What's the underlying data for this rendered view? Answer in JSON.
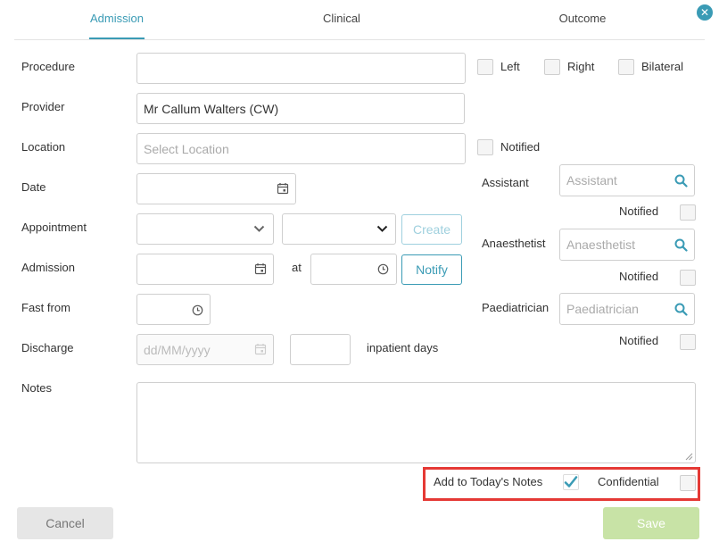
{
  "tabs": [
    {
      "label": "Admission",
      "active": true
    },
    {
      "label": "Clinical",
      "active": false
    },
    {
      "label": "Outcome",
      "active": false
    }
  ],
  "close": {
    "icon": "close-icon"
  },
  "form": {
    "procedure": {
      "label": "Procedure",
      "value": ""
    },
    "side_options": [
      {
        "label": "Left",
        "checked": false
      },
      {
        "label": "Right",
        "checked": false
      },
      {
        "label": "Bilateral",
        "checked": false
      }
    ],
    "provider": {
      "label": "Provider",
      "value": "Mr Callum Walters (CW)"
    },
    "location": {
      "label": "Location",
      "placeholder": "Select Location",
      "notified_label": "Notified"
    },
    "date": {
      "label": "Date",
      "value": ""
    },
    "appointment": {
      "label": "Appointment",
      "create_label": "Create"
    },
    "admission": {
      "label": "Admission",
      "at_label": "at",
      "notify_label": "Notify"
    },
    "fast_from": {
      "label": "Fast from"
    },
    "discharge": {
      "label": "Discharge",
      "placeholder": "dd/MM/yyyy",
      "days_suffix": "inpatient days"
    },
    "notes": {
      "label": "Notes",
      "value": ""
    }
  },
  "staff": {
    "assistant": {
      "label": "Assistant",
      "placeholder": "Assistant",
      "notified_label": "Notified"
    },
    "anaesthetist": {
      "label": "Anaesthetist",
      "placeholder": "Anaesthetist",
      "notified_label": "Notified"
    },
    "paediatrician": {
      "label": "Paediatrician",
      "placeholder": "Paediatrician",
      "notified_label": "Notified"
    }
  },
  "footer": {
    "add_to_notes_label": "Add to Today's Notes",
    "add_to_notes_checked": true,
    "confidential_label": "Confidential",
    "confidential_checked": false,
    "cancel_label": "Cancel",
    "save_label": "Save"
  },
  "colors": {
    "accent": "#3a9bb5",
    "save_disabled": "#c8e3a6",
    "highlight": "#e53935"
  }
}
